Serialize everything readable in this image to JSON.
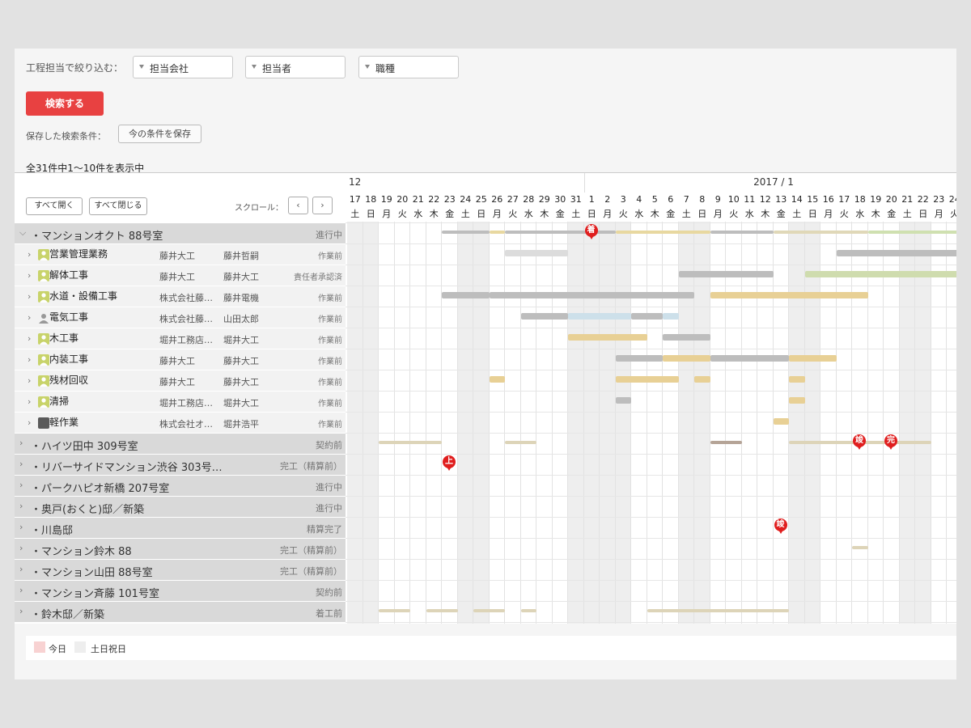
{
  "filters": {
    "label": "工程担当で絞り込む：",
    "company_placeholder": "担当会社",
    "person_placeholder": "担当者",
    "job_placeholder": "職種"
  },
  "actions": {
    "search_label": "検索する",
    "saved_label": "保存した検索条件：",
    "save_label": "今の条件を保存"
  },
  "count_text": "全31件中1〜10件を表示中",
  "toolbar": {
    "expand_all": "すべて開く",
    "collapse_all": "すべて閉じる",
    "scroll_label": "スクロール：",
    "prev": "‹",
    "next": "›"
  },
  "months": [
    {
      "label": "12",
      "start_index": 0
    },
    {
      "label": "2017 / 1",
      "start_index": 15
    }
  ],
  "days": [
    {
      "d": "17",
      "w": "土"
    },
    {
      "d": "18",
      "w": "日"
    },
    {
      "d": "19",
      "w": "月"
    },
    {
      "d": "20",
      "w": "火"
    },
    {
      "d": "21",
      "w": "水"
    },
    {
      "d": "22",
      "w": "木"
    },
    {
      "d": "23",
      "w": "金"
    },
    {
      "d": "24",
      "w": "土"
    },
    {
      "d": "25",
      "w": "日"
    },
    {
      "d": "26",
      "w": "月"
    },
    {
      "d": "27",
      "w": "火"
    },
    {
      "d": "28",
      "w": "水"
    },
    {
      "d": "29",
      "w": "木"
    },
    {
      "d": "30",
      "w": "金"
    },
    {
      "d": "31",
      "w": "土"
    },
    {
      "d": "1",
      "w": "日"
    },
    {
      "d": "2",
      "w": "月"
    },
    {
      "d": "3",
      "w": "火"
    },
    {
      "d": "4",
      "w": "水"
    },
    {
      "d": "5",
      "w": "木"
    },
    {
      "d": "6",
      "w": "金"
    },
    {
      "d": "7",
      "w": "土"
    },
    {
      "d": "8",
      "w": "日"
    },
    {
      "d": "9",
      "w": "月"
    },
    {
      "d": "10",
      "w": "火"
    },
    {
      "d": "11",
      "w": "水"
    },
    {
      "d": "12",
      "w": "木"
    },
    {
      "d": "13",
      "w": "金"
    },
    {
      "d": "14",
      "w": "土"
    },
    {
      "d": "15",
      "w": "日"
    },
    {
      "d": "16",
      "w": "月"
    },
    {
      "d": "17",
      "w": "火"
    },
    {
      "d": "18",
      "w": "水"
    },
    {
      "d": "19",
      "w": "木"
    },
    {
      "d": "20",
      "w": "金"
    },
    {
      "d": "21",
      "w": "土"
    },
    {
      "d": "22",
      "w": "日"
    },
    {
      "d": "23",
      "w": "月"
    },
    {
      "d": "24",
      "w": "火"
    }
  ],
  "holiday_indices": [
    0,
    1,
    7,
    8,
    14,
    15,
    16,
    17,
    21,
    22,
    28,
    29,
    35,
    36
  ],
  "rows": [
    {
      "type": "project",
      "name": "・マンションオクト 88号室",
      "status": "進行中",
      "expanded": true
    },
    {
      "type": "task",
      "icon": "default-avatar-icon",
      "name": "営業管理業務",
      "company": "藤井大工",
      "person": "藤井哲嗣",
      "status": "作業前"
    },
    {
      "type": "task",
      "icon": "default-avatar-icon",
      "name": "解体工事",
      "company": "藤井大工",
      "person": "藤井大工",
      "status": "責任者承認済"
    },
    {
      "type": "task",
      "icon": "default-avatar-icon",
      "name": "水道・設備工事",
      "company": "株式会社藤…",
      "person": "藤井電機",
      "status": "作業前"
    },
    {
      "type": "task",
      "icon": "user-silhouette-icon",
      "name": "電気工事",
      "company": "株式会社藤…",
      "person": "山田太郎",
      "status": "作業前"
    },
    {
      "type": "task",
      "icon": "default-avatar-icon",
      "name": "木工事",
      "company": "堀井工務店…",
      "person": "堀井大工",
      "status": "作業前"
    },
    {
      "type": "task",
      "icon": "default-avatar-icon",
      "name": "内装工事",
      "company": "藤井大工",
      "person": "藤井大工",
      "status": "作業前"
    },
    {
      "type": "task",
      "icon": "default-avatar-icon",
      "name": "残材回収",
      "company": "藤井大工",
      "person": "藤井大工",
      "status": "作業前"
    },
    {
      "type": "task",
      "icon": "default-avatar-icon",
      "name": "清掃",
      "company": "堀井工務店…",
      "person": "堀井大工",
      "status": "作業前"
    },
    {
      "type": "task",
      "icon": "photo-avatar-icon",
      "name": "軽作業",
      "company": "株式会社オ…",
      "person": "堀井浩平",
      "status": "作業前"
    },
    {
      "type": "project",
      "name": "・ハイツ田中 309号室",
      "status": "契約前",
      "expanded": false
    },
    {
      "type": "project",
      "name": "・リバーサイドマンション渋谷 303号…",
      "status": "完工（精算前）",
      "expanded": false
    },
    {
      "type": "project",
      "name": "・パークハピオ新橋 207号室",
      "status": "進行中",
      "expanded": false
    },
    {
      "type": "project",
      "name": "・奥戸(おくと)邸／新築",
      "status": "進行中",
      "expanded": false
    },
    {
      "type": "project",
      "name": "・川島邸",
      "status": "精算完了",
      "expanded": false
    },
    {
      "type": "project",
      "name": "・マンション鈴木 88",
      "status": "完工（精算前）",
      "expanded": false
    },
    {
      "type": "project",
      "name": "・マンション山田 88号室",
      "status": "完工（精算前）",
      "expanded": false
    },
    {
      "type": "project",
      "name": "・マンション斉藤 101号室",
      "status": "契約前",
      "expanded": false
    },
    {
      "type": "project",
      "name": "・鈴木邸／新築",
      "status": "着工前",
      "expanded": false
    }
  ],
  "bars": [
    {
      "row": 0,
      "start": 6,
      "end": 9,
      "color": "#bdbdbd"
    },
    {
      "row": 0,
      "start": 9,
      "end": 10,
      "color": "#e8d8a0"
    },
    {
      "row": 0,
      "start": 10,
      "end": 17,
      "color": "#bdbdbd"
    },
    {
      "row": 0,
      "start": 17,
      "end": 23,
      "color": "#e8d8a0"
    },
    {
      "row": 0,
      "start": 23,
      "end": 27,
      "color": "#bdbdbd"
    },
    {
      "row": 0,
      "start": 27,
      "end": 33,
      "color": "#e0d8b8"
    },
    {
      "row": 0,
      "start": 33,
      "end": 39,
      "color": "#cfe0b0"
    },
    {
      "row": 1,
      "start": 10,
      "end": 14,
      "color": "#dcdcdc"
    },
    {
      "row": 1,
      "start": 31,
      "end": 39,
      "color": "#bdbdbd"
    },
    {
      "row": 2,
      "start": 21,
      "end": 27,
      "color": "#bdbdbd"
    },
    {
      "row": 2,
      "start": 29,
      "end": 39,
      "color": "#cfdcae"
    },
    {
      "row": 3,
      "start": 6,
      "end": 9,
      "color": "#bdbdbd"
    },
    {
      "row": 3,
      "start": 9,
      "end": 22,
      "color": "#bdbdbd"
    },
    {
      "row": 3,
      "start": 23,
      "end": 33,
      "color": "#e8d095"
    },
    {
      "row": 4,
      "start": 11,
      "end": 14,
      "color": "#bdbdbd"
    },
    {
      "row": 4,
      "start": 14,
      "end": 18,
      "color": "#cde0ea"
    },
    {
      "row": 4,
      "start": 18,
      "end": 20,
      "color": "#bdbdbd"
    },
    {
      "row": 4,
      "start": 20,
      "end": 21,
      "color": "#cde0ea"
    },
    {
      "row": 5,
      "start": 14,
      "end": 19,
      "color": "#e8d095"
    },
    {
      "row": 5,
      "start": 20,
      "end": 23,
      "color": "#bdbdbd"
    },
    {
      "row": 6,
      "start": 17,
      "end": 20,
      "color": "#bdbdbd"
    },
    {
      "row": 6,
      "start": 20,
      "end": 23,
      "color": "#e8d095"
    },
    {
      "row": 6,
      "start": 23,
      "end": 28,
      "color": "#bdbdbd"
    },
    {
      "row": 6,
      "start": 28,
      "end": 31,
      "color": "#e8d095"
    },
    {
      "row": 7,
      "start": 9,
      "end": 10,
      "color": "#e8d095"
    },
    {
      "row": 7,
      "start": 17,
      "end": 21,
      "color": "#e8d095"
    },
    {
      "row": 7,
      "start": 22,
      "end": 23,
      "color": "#e8d095"
    },
    {
      "row": 7,
      "start": 28,
      "end": 29,
      "color": "#e8d095"
    },
    {
      "row": 8,
      "start": 17,
      "end": 18,
      "color": "#bdbdbd"
    },
    {
      "row": 8,
      "start": 28,
      "end": 29,
      "color": "#e8d095"
    },
    {
      "row": 9,
      "start": 27,
      "end": 28,
      "color": "#e8d095"
    },
    {
      "row": 10,
      "start": 2,
      "end": 6,
      "color": "#ddd4b8"
    },
    {
      "row": 10,
      "start": 10,
      "end": 12,
      "color": "#ddd4b8"
    },
    {
      "row": 10,
      "start": 23,
      "end": 25,
      "color": "#b5a497"
    },
    {
      "row": 10,
      "start": 28,
      "end": 37,
      "color": "#ddd4b8"
    },
    {
      "row": 15,
      "start": 32,
      "end": 33,
      "color": "#ddd4b8"
    },
    {
      "row": 18,
      "start": 2,
      "end": 4,
      "color": "#ddd4b8"
    },
    {
      "row": 18,
      "start": 5,
      "end": 7,
      "color": "#ddd4b8"
    },
    {
      "row": 18,
      "start": 8,
      "end": 10,
      "color": "#ddd4b8"
    },
    {
      "row": 18,
      "start": 11,
      "end": 12,
      "color": "#ddd4b8"
    },
    {
      "row": 18,
      "start": 19,
      "end": 28,
      "color": "#ddd4b8"
    }
  ],
  "markers": [
    {
      "row": 0,
      "day": 15,
      "label": "着"
    },
    {
      "row": 10,
      "day": 32,
      "label": "竣"
    },
    {
      "row": 10,
      "day": 34,
      "label": "完"
    },
    {
      "row": 11,
      "day": 6,
      "label": "上"
    },
    {
      "row": 14,
      "day": 27,
      "label": "竣"
    }
  ],
  "legend": {
    "today_label": "今日",
    "holiday_label": "土日祝日",
    "today_color": "#f8d2d2",
    "holiday_color": "#eeeeee"
  }
}
